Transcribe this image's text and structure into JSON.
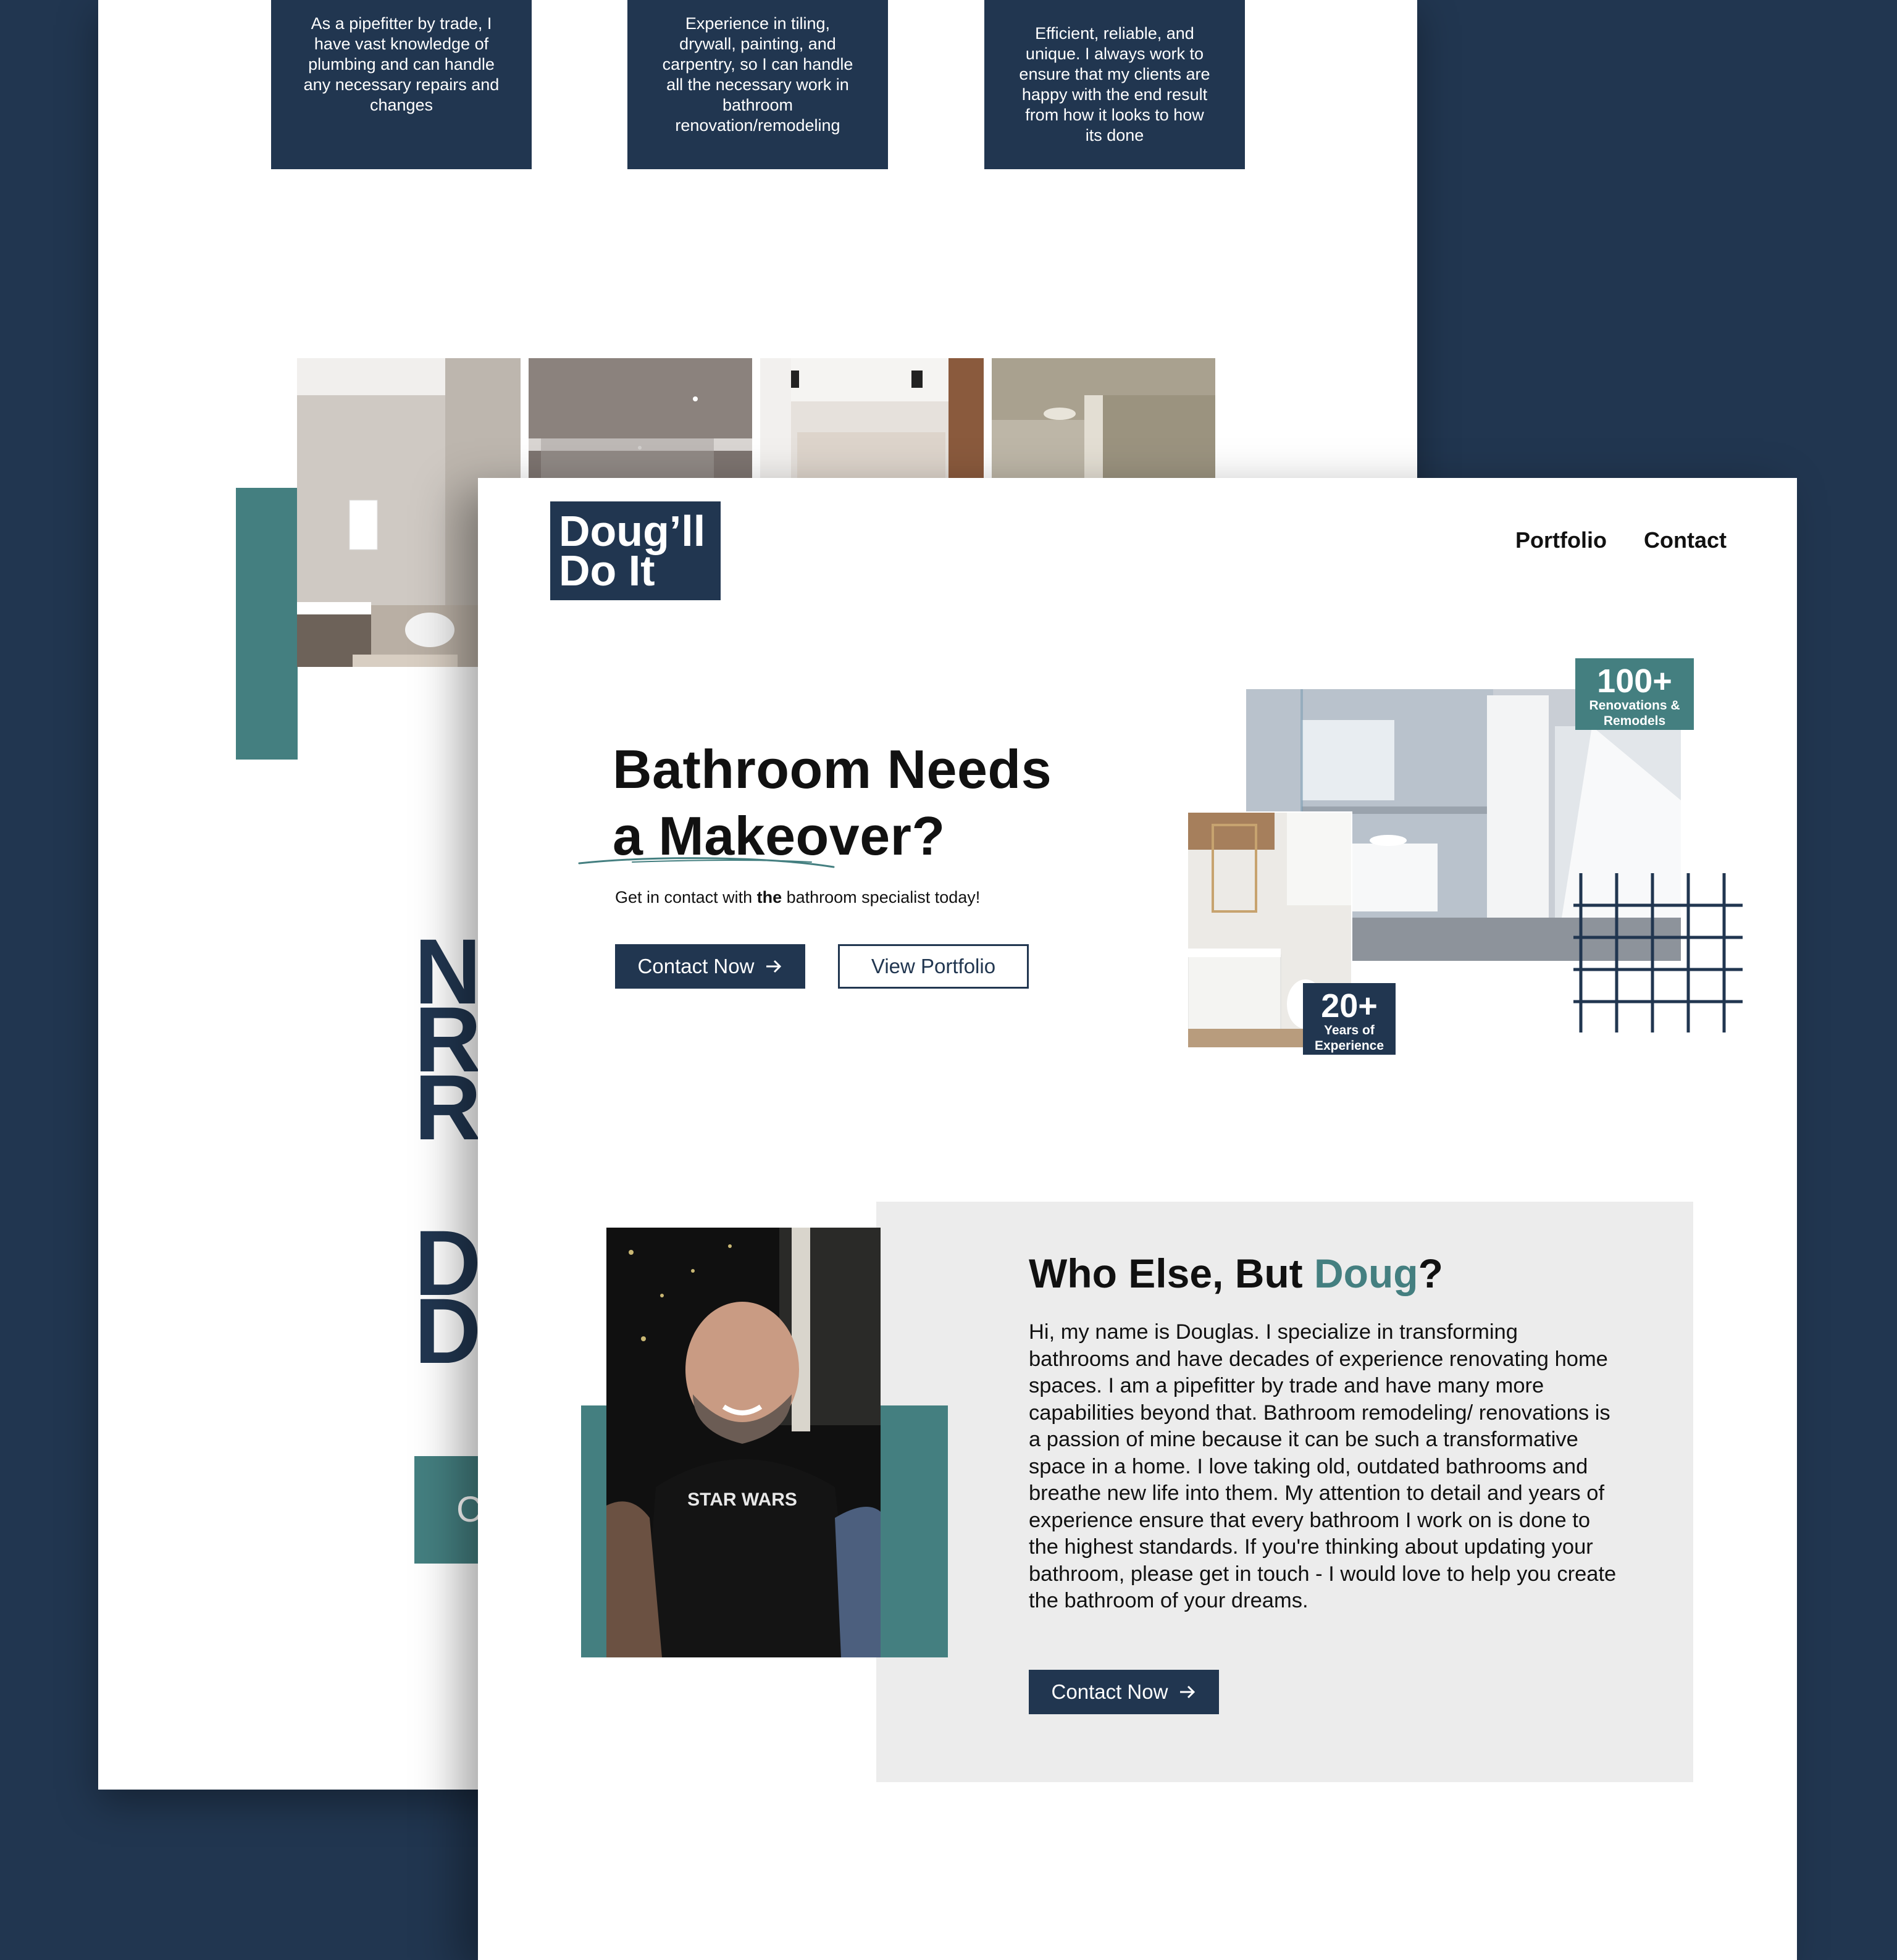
{
  "colors": {
    "navy": "#213650",
    "teal": "#447f80",
    "background": "#213650",
    "panel_gray": "#ececec"
  },
  "back_page": {
    "cards": [
      {
        "text": "As a pipefitter by trade, I have vast knowledge of plumbing and can handle any necessary repairs and changes"
      },
      {
        "text": "Experience in tiling, drywall, painting, and carpentry, so I can handle all the necessary work in bathroom renovation/remodeling"
      },
      {
        "text": "Efficient, reliable, and unique. I always work to ensure that my clients are happy with the end result from how it looks to how its done"
      }
    ],
    "big_letters_1": [
      "N",
      "R",
      "R"
    ],
    "big_letters_2": [
      "D",
      "D"
    ],
    "button_fragment": "C"
  },
  "front_page": {
    "logo": {
      "line1": "Doug’ll",
      "line2": "Do It"
    },
    "nav": {
      "portfolio": "Portfolio",
      "contact": "Contact"
    },
    "hero": {
      "title_line1": "Bathroom Needs",
      "title_line2": "a Makeover?",
      "subtitle_pre": "Get in contact with ",
      "subtitle_bold": "the",
      "subtitle_post": " bathroom specialist today!",
      "contact_button": "Contact Now",
      "portfolio_button": "View Portfolio",
      "arrow_icon": "arrow-right-icon"
    },
    "badges": {
      "renovations": {
        "number": "100+",
        "label_line1": "Renovations &",
        "label_line2": "Remodels"
      },
      "experience": {
        "number": "20+",
        "label_line1": "Years of",
        "label_line2": "Experience"
      }
    },
    "about": {
      "title_pre": "Who Else, But ",
      "title_accent": "Doug",
      "title_post": "?",
      "body": "Hi, my name is Douglas. I specialize in transforming bathrooms and have decades of experience renovating home spaces. I am a pipefitter by trade and have many more capabilities beyond that. Bathroom remodeling/ renovations is a passion of mine because it can be such a transformative space in a home. I love taking old, outdated bathrooms and breathe new life into them. My attention to detail and years of experience ensure that every bathroom I work on is done to the highest standards. If you're thinking about updating your bathroom, please get in touch - I would love to help you create the bathroom of your dreams.",
      "contact_button": "Contact Now",
      "photo_shirt_text": "STAR WARS"
    }
  }
}
